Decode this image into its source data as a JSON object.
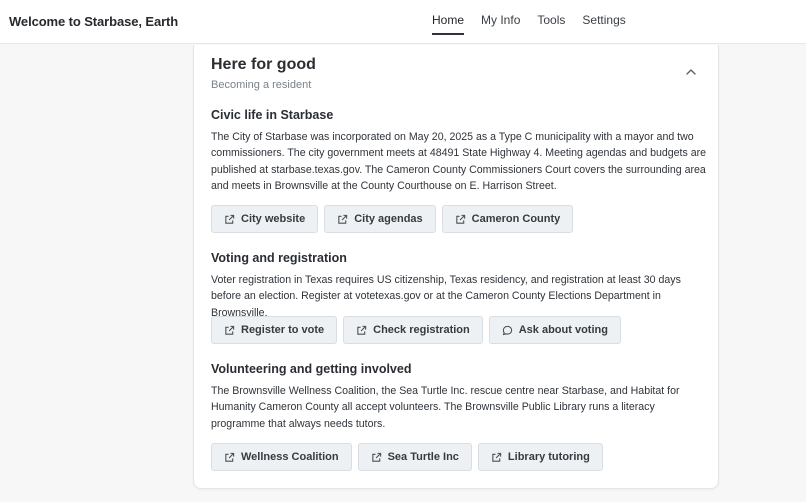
{
  "header": {
    "title": "Welcome to Starbase, Earth",
    "nav": [
      {
        "label": "Home"
      },
      {
        "label": "My Info"
      },
      {
        "label": "Tools"
      },
      {
        "label": "Settings"
      }
    ]
  },
  "card": {
    "title": "Here for good",
    "subtitle": "Becoming a resident",
    "sections": [
      {
        "title": "Civic life in Starbase",
        "body": "The City of Starbase was incorporated on May 20, 2025 as a Type C municipality with a mayor and two commissioners. The city government meets at 48491 State Highway 4. Meeting agendas and budgets are published at starbase.texas.gov. The Cameron County Commissioners Court covers the surrounding area and meets in Brownsville at the County Courthouse on E. Harrison Street.",
        "buttons": [
          {
            "label": "City website",
            "icon": "external-link-icon"
          },
          {
            "label": "City agendas",
            "icon": "external-link-icon"
          },
          {
            "label": "Cameron County",
            "icon": "external-link-icon"
          }
        ]
      },
      {
        "title": "Voting and registration",
        "body": "Voter registration in Texas requires US citizenship, Texas residency, and registration at least 30 days before an election. Register at votetexas.gov or at the Cameron County Elections Department in Brownsville.",
        "buttons": [
          {
            "label": "Register to vote",
            "icon": "external-link-icon"
          },
          {
            "label": "Check registration",
            "icon": "external-link-icon"
          },
          {
            "label": "Ask about voting",
            "icon": "chat-bubble-icon"
          }
        ]
      },
      {
        "title": "Volunteering and getting involved",
        "body": "The Brownsville Wellness Coalition, the Sea Turtle Inc. rescue centre near Starbase, and Habitat for Humanity Cameron County all accept volunteers. The Brownsville Public Library runs a literacy programme that always needs tutors.",
        "buttons": [
          {
            "label": "Wellness Coalition",
            "icon": "external-link-icon"
          },
          {
            "label": "Sea Turtle Inc",
            "icon": "external-link-icon"
          },
          {
            "label": "Library tutoring",
            "icon": "external-link-icon"
          }
        ]
      }
    ]
  }
}
